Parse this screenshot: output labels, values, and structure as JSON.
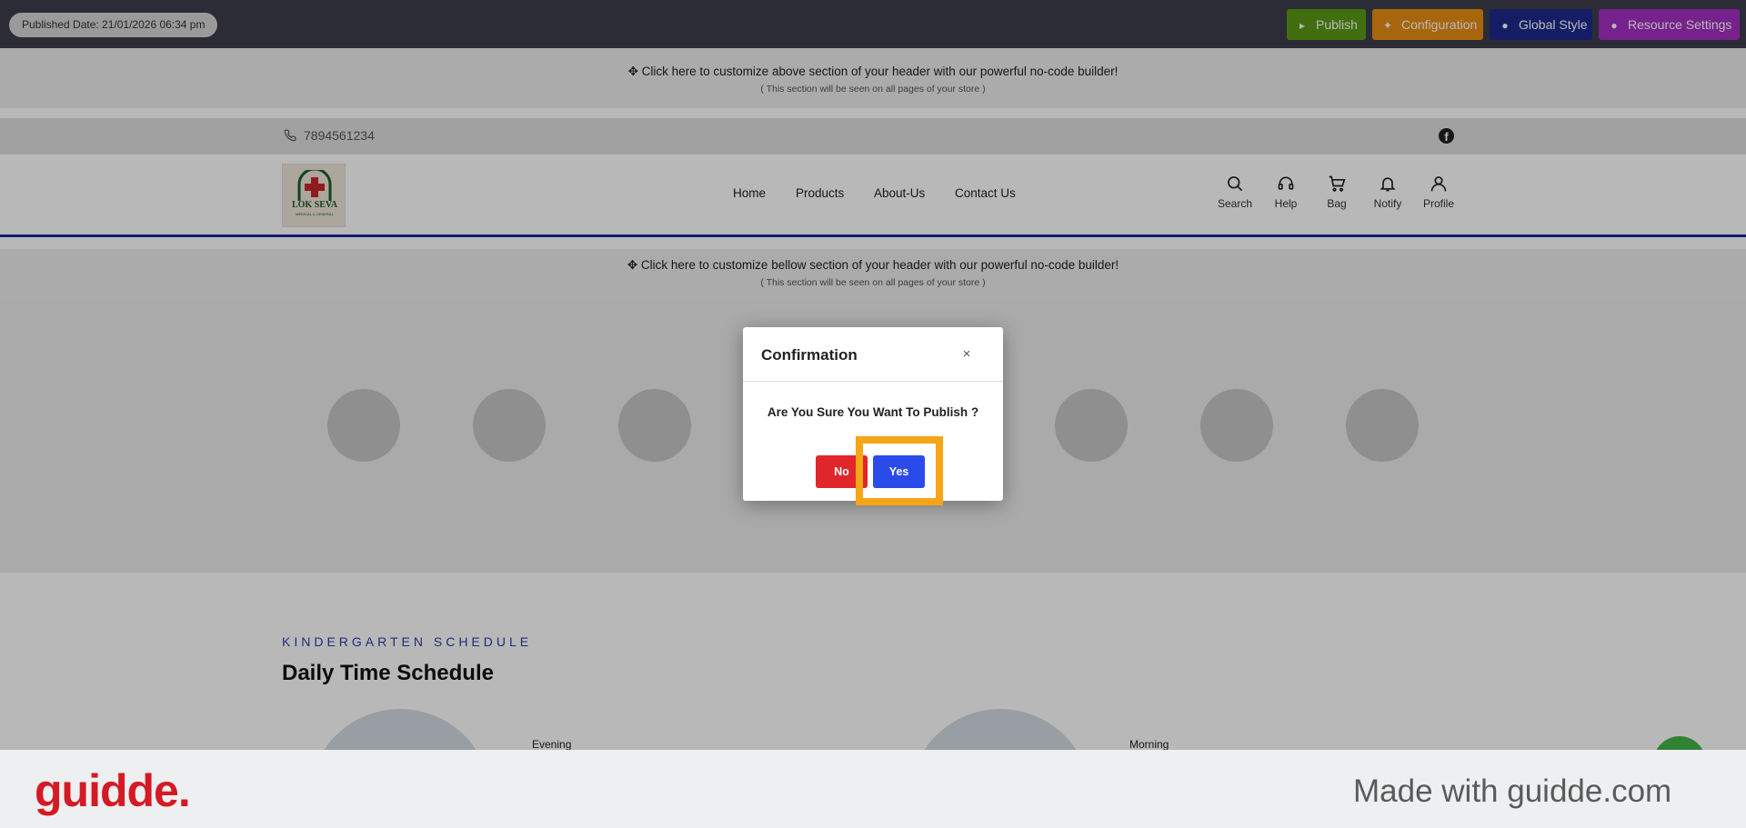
{
  "topbar": {
    "published_date": "Published Date: 21/01/2026 06:34 pm",
    "buttons": [
      {
        "label": "Publish",
        "icon": "megaphone-icon",
        "color": "#5a9a17"
      },
      {
        "label": "Configuration",
        "icon": "sparkle-icon",
        "color": "#e88e12"
      },
      {
        "label": "Global Style",
        "icon": "globe-icon",
        "color": "#1e2a8c"
      },
      {
        "label": "Resource Settings",
        "icon": "globe-icon",
        "color": "#a42ec2"
      }
    ]
  },
  "customize_top": {
    "title": "✥ Click here to customize above section of your header with our powerful no-code builder!",
    "subtitle": "( This section will be seen on all pages of your store )"
  },
  "contact": {
    "phone": "7894561234",
    "social_icon": "facebook-icon"
  },
  "header": {
    "logo_text": "LOK SEVA",
    "logo_subtext": "MEDICAL & GENERAL",
    "nav": [
      "Home",
      "Products",
      "About-Us",
      "Contact Us"
    ],
    "actions": [
      {
        "label": "Search",
        "icon": "search-icon"
      },
      {
        "label": "Help",
        "icon": "headset-icon"
      },
      {
        "label": "Bag",
        "icon": "cart-icon"
      },
      {
        "label": "Notify",
        "icon": "bell-icon"
      },
      {
        "label": "Profile",
        "icon": "user-icon"
      }
    ]
  },
  "customize_bottom": {
    "title": "✥ Click here to customize bellow section of your header with our powerful no-code builder!",
    "subtitle": "( This section will be seen on all pages of your store )"
  },
  "schedule": {
    "kicker": "KINDERGARTEN SCHEDULE",
    "title": "Daily Time Schedule",
    "items": [
      "Evening",
      "Morning"
    ]
  },
  "modal": {
    "title": "Confirmation",
    "close": "×",
    "message": "Are You Sure You Want To Publish ?",
    "no_label": "No",
    "yes_label": "Yes"
  },
  "watermark": {
    "logo": "guidde.",
    "text": "Made with guidde.com"
  },
  "colors": {
    "accent_blue": "#2a4bea",
    "danger_red": "#e0262b",
    "highlight": "#f6a516",
    "header_border": "#1a2a9c"
  }
}
